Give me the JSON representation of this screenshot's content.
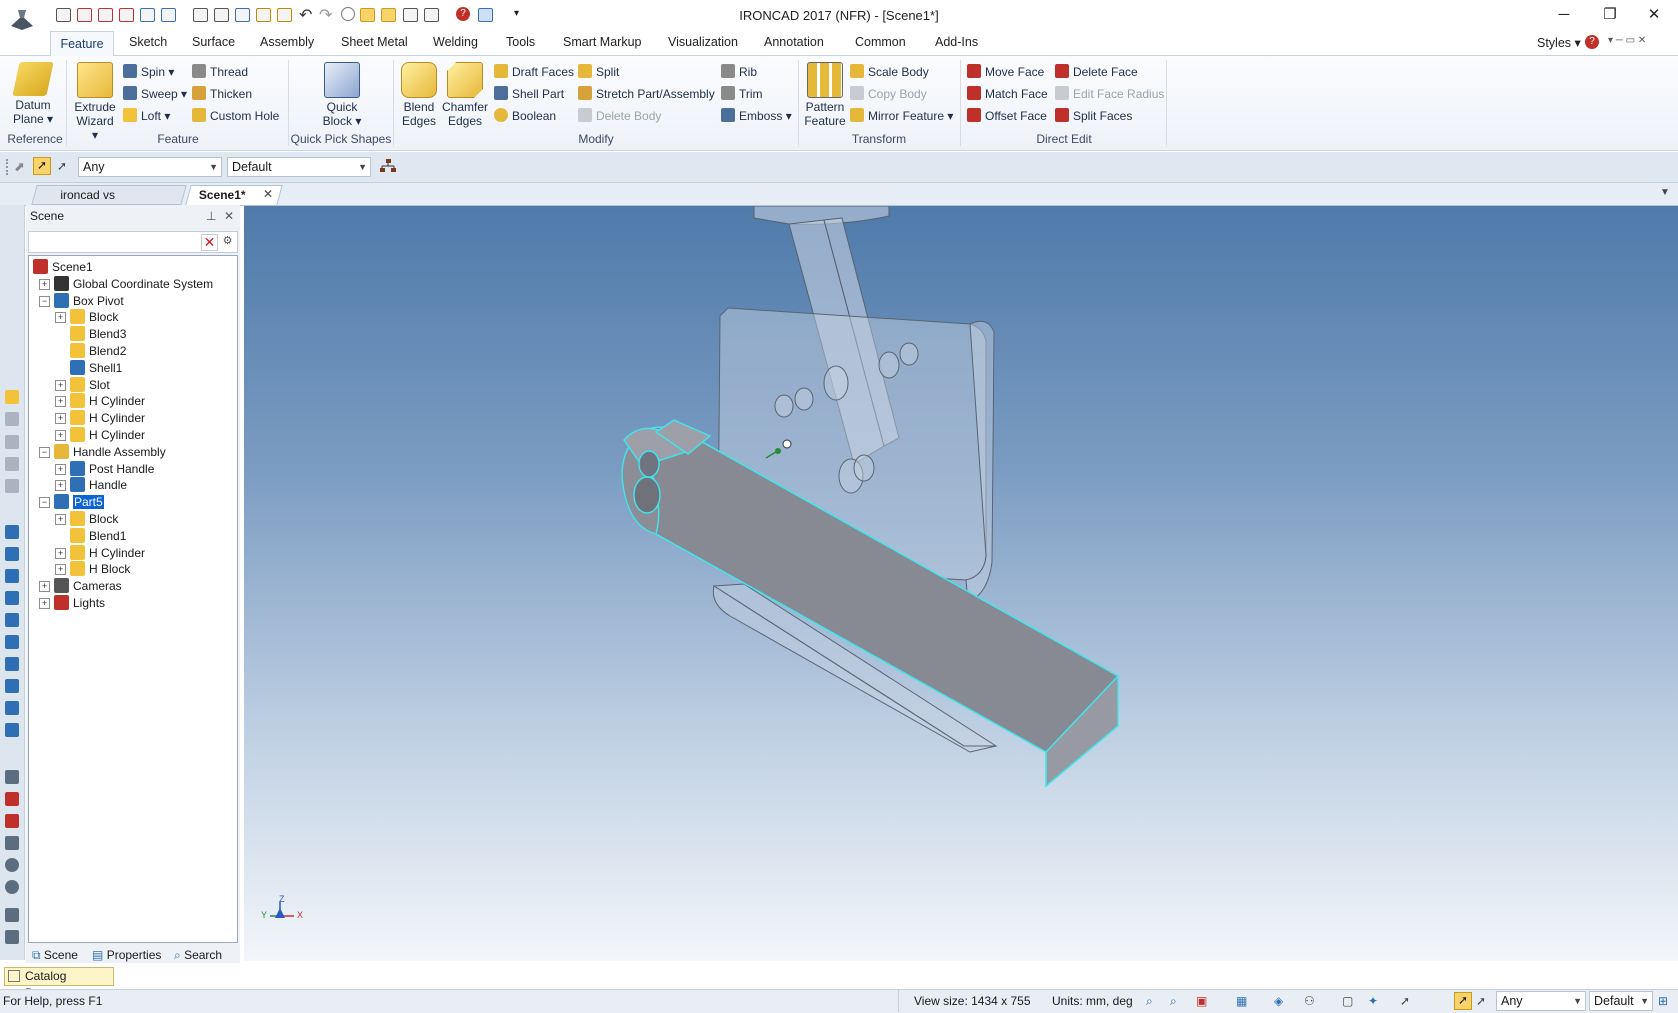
{
  "window": {
    "title": "IRONCAD 2017 (NFR) - [Scene1*]",
    "controls": {
      "minimize": "─",
      "restore": "❐",
      "close": "✕"
    }
  },
  "ribbon_tabs": [
    "Feature",
    "Sketch",
    "Surface",
    "Assembly",
    "Sheet Metal",
    "Welding",
    "Tools",
    "Smart Markup",
    "Visualization",
    "Annotation",
    "Common",
    "Add-Ins"
  ],
  "ribbon_right": {
    "styles": "Styles"
  },
  "ribbon": {
    "reference": {
      "label": "Reference",
      "datum_plane": "Datum Plane"
    },
    "feature": {
      "label": "Feature",
      "extrude_wizard": "Extrude Wizard",
      "spin": "Spin",
      "sweep": "Sweep",
      "loft": "Loft",
      "thread": "Thread",
      "thicken": "Thicken",
      "custom_hole": "Custom Hole"
    },
    "quick_pick": {
      "label": "Quick Pick Shapes",
      "quick_block": "Quick Block"
    },
    "modify": {
      "label": "Modify",
      "blend_edges": "Blend Edges",
      "chamfer_edges": "Chamfer Edges",
      "draft_faces": "Draft Faces",
      "shell_part": "Shell Part",
      "boolean": "Boolean",
      "split": "Split",
      "stretch": "Stretch Part/Assembly",
      "delete_body": "Delete Body",
      "rib": "Rib",
      "trim": "Trim",
      "emboss": "Emboss"
    },
    "transform": {
      "label": "Transform",
      "pattern_feature": "Pattern Feature",
      "scale_body": "Scale Body",
      "copy_body": "Copy Body",
      "mirror_feature": "Mirror Feature"
    },
    "direct_edit": {
      "label": "Direct Edit",
      "move_face": "Move Face",
      "match_face": "Match Face",
      "offset_face": "Offset Face",
      "delete_face": "Delete Face",
      "edit_face_radius": "Edit Face Radius",
      "split_faces": "Split Faces"
    }
  },
  "selection_bar": {
    "filter": "Any",
    "style": "Default"
  },
  "doc_tabs": [
    "ironcad vs f...ssembly",
    "Scene1*"
  ],
  "scene_panel": {
    "title": "Scene",
    "tree": [
      {
        "label": "Scene1",
        "level": 0,
        "toggle": "",
        "icon": "scene-icon"
      },
      {
        "label": "Global Coordinate System",
        "level": 1,
        "toggle": "+",
        "icon": "coordinate-system-icon"
      },
      {
        "label": "Box Pivot",
        "level": 1,
        "toggle": "−",
        "icon": "part-icon"
      },
      {
        "label": "Block",
        "level": 2,
        "toggle": "+",
        "icon": "block-feature-icon"
      },
      {
        "label": "Blend3",
        "level": 2,
        "toggle": "",
        "icon": "blend-feature-icon"
      },
      {
        "label": "Blend2",
        "level": 2,
        "toggle": "",
        "icon": "blend-feature-icon"
      },
      {
        "label": "Shell1",
        "level": 2,
        "toggle": "",
        "icon": "shell-feature-icon"
      },
      {
        "label": "Slot",
        "level": 2,
        "toggle": "+",
        "icon": "block-feature-icon"
      },
      {
        "label": "H Cylinder",
        "level": 2,
        "toggle": "+",
        "icon": "cylinder-feature-icon"
      },
      {
        "label": "H Cylinder",
        "level": 2,
        "toggle": "+",
        "icon": "cylinder-feature-icon"
      },
      {
        "label": "H Cylinder",
        "level": 2,
        "toggle": "+",
        "icon": "cylinder-feature-icon"
      },
      {
        "label": "Handle Assembly",
        "level": 1,
        "toggle": "−",
        "icon": "assembly-icon"
      },
      {
        "label": "Post Handle",
        "level": 2,
        "toggle": "+",
        "icon": "part-icon"
      },
      {
        "label": "Handle",
        "level": 2,
        "toggle": "+",
        "icon": "part-icon"
      },
      {
        "label": "Part5",
        "level": 1,
        "toggle": "−",
        "icon": "part-icon",
        "selected": true
      },
      {
        "label": "Block",
        "level": 2,
        "toggle": "+",
        "icon": "block-feature-icon"
      },
      {
        "label": "Blend1",
        "level": 2,
        "toggle": "",
        "icon": "blend-feature-icon"
      },
      {
        "label": "H Cylinder",
        "level": 2,
        "toggle": "+",
        "icon": "cylinder-feature-icon"
      },
      {
        "label": "H Block",
        "level": 2,
        "toggle": "+",
        "icon": "block-feature-icon"
      },
      {
        "label": "Cameras",
        "level": 1,
        "toggle": "+",
        "icon": "camera-icon"
      },
      {
        "label": "Lights",
        "level": 1,
        "toggle": "+",
        "icon": "light-icon"
      }
    ],
    "bottom_tabs": {
      "scene": "Scene",
      "properties": "Properties",
      "search": "Search"
    }
  },
  "triad": {
    "x": "X",
    "y": "Y",
    "z": "Z"
  },
  "catalog_browser": "Catalog Browser",
  "status": {
    "help": "For Help, press F1",
    "view_size": "View size: 1434 x  755",
    "units": "Units: mm, deg",
    "filter": "Any",
    "style": "Default"
  },
  "colors": {
    "selection_highlight": "#0a64d6",
    "edge_highlight": "#3fe6ee",
    "accent": "#1a3c6e"
  }
}
